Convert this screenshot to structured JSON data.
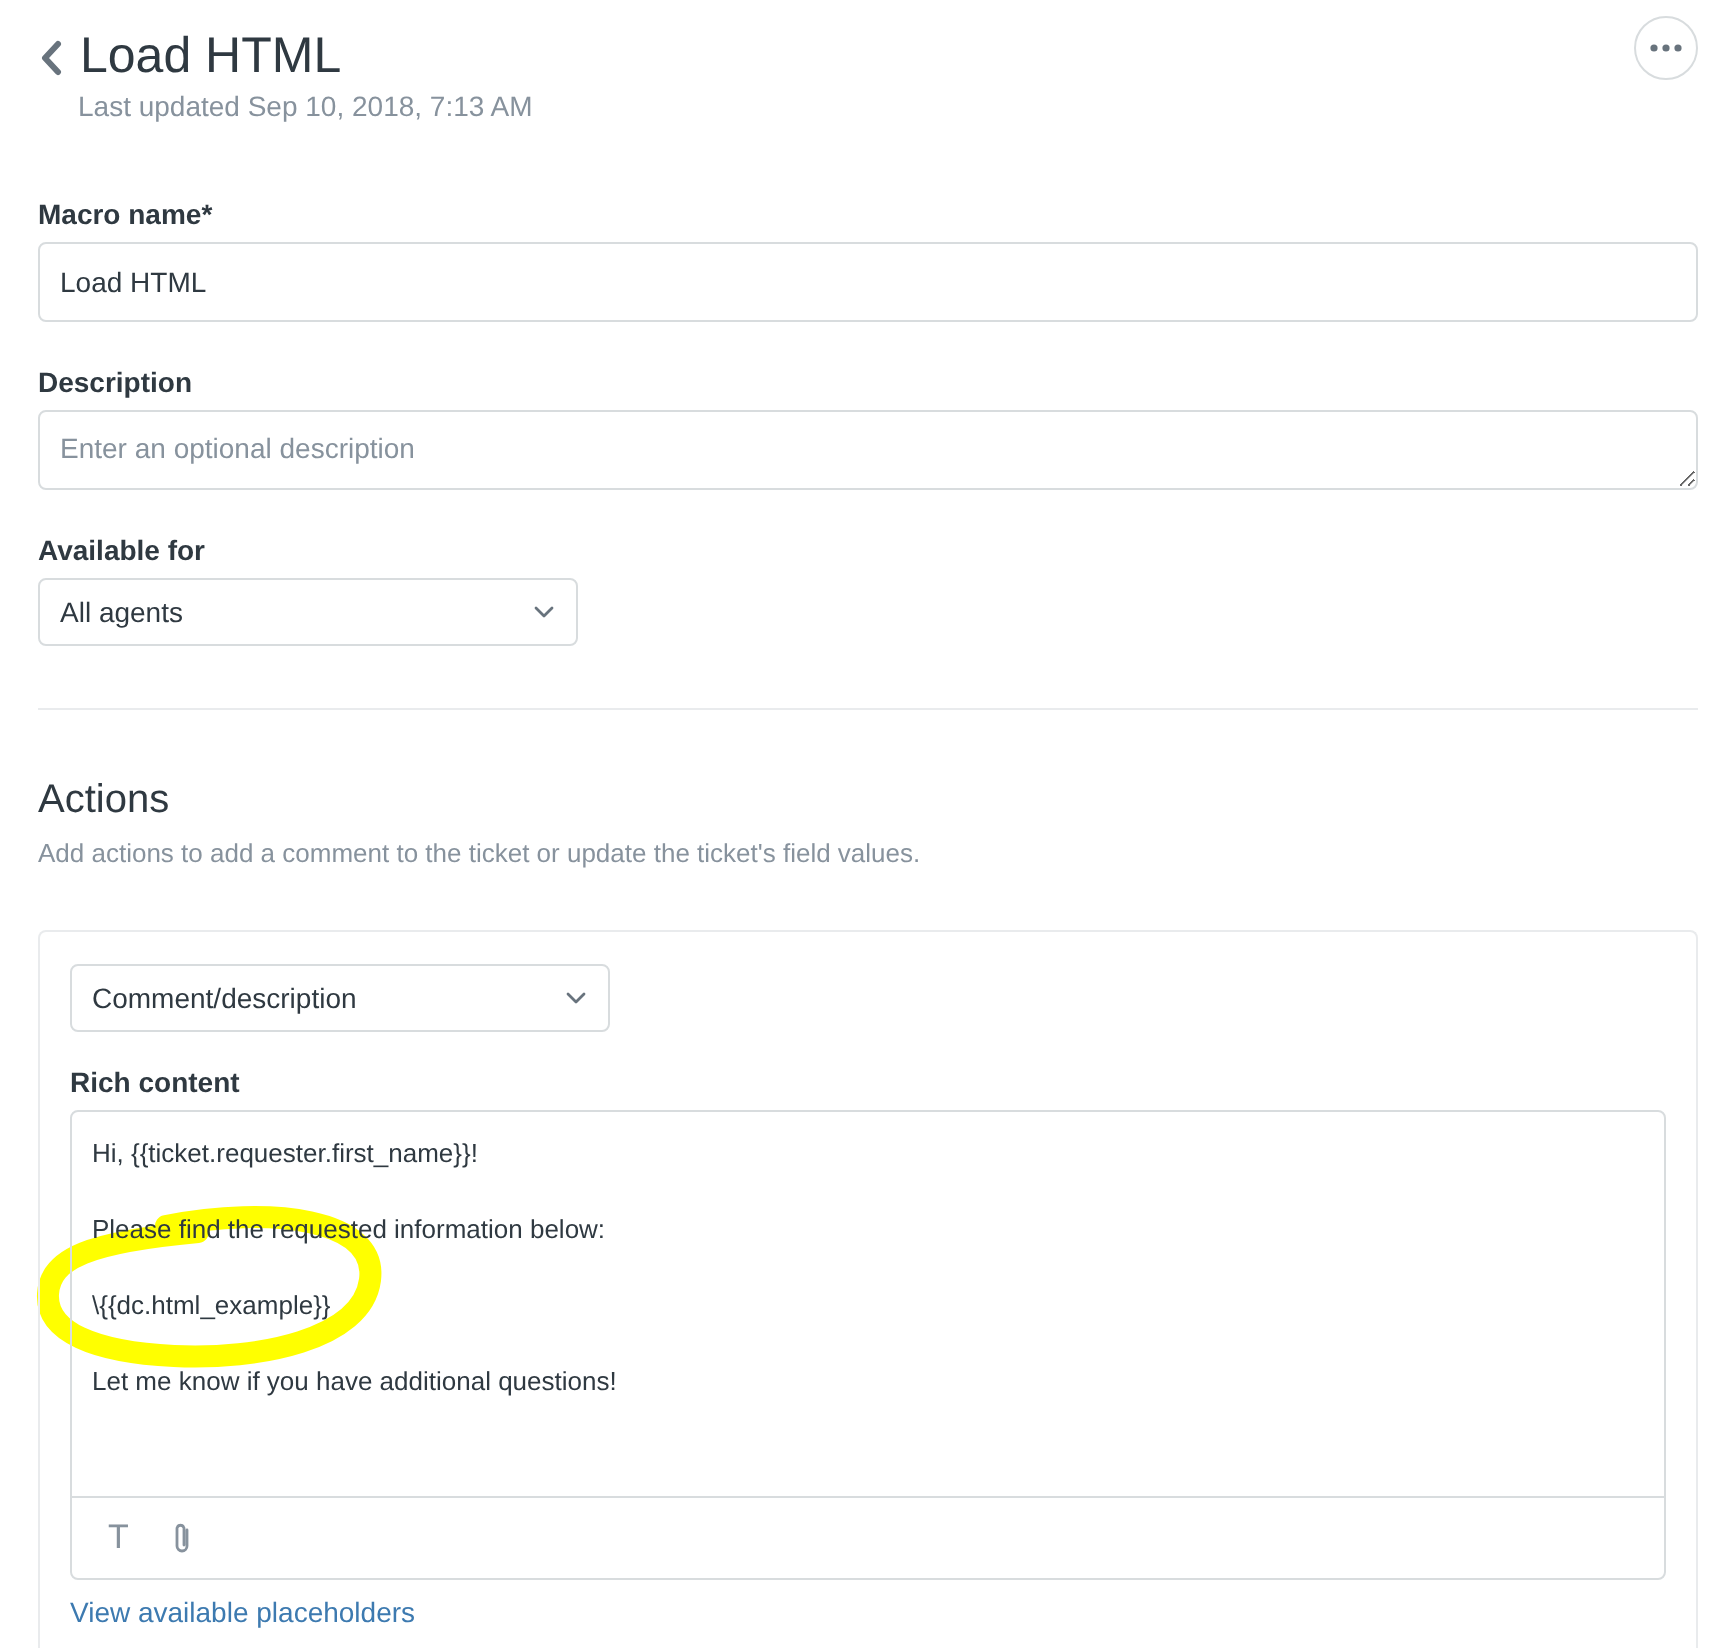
{
  "header": {
    "title": "Load HTML",
    "subtitle": "Last updated Sep 10, 2018, 7:13 AM"
  },
  "fields": [
    {
      "kind": "input",
      "label": "Macro name*",
      "value": "Load HTML"
    },
    {
      "kind": "textarea",
      "label": "Description",
      "placeholder": "Enter an optional description"
    },
    {
      "kind": "select",
      "label": "Available for",
      "value": "All agents"
    }
  ],
  "actions": {
    "title": "Actions",
    "description": "Add actions to add a comment to the ticket or update the ticket's field values.",
    "items": [
      {
        "type": "Comment/description",
        "content_label": "Rich content",
        "lines": [
          {
            "text": "Hi, {{ticket.requester.first_name}}!",
            "highlighted": false
          },
          {
            "text": "Please find the requested information below:",
            "highlighted": false
          },
          {
            "text": "\\{{dc.html_example}}",
            "highlighted": true
          },
          {
            "text": "Let me know if you have additional questions!",
            "highlighted": false
          }
        ],
        "toolbar": [
          {
            "kind": "glyph",
            "glyph": "T"
          },
          {
            "kind": "attachment"
          }
        ],
        "link": "View available placeholders"
      }
    ]
  }
}
